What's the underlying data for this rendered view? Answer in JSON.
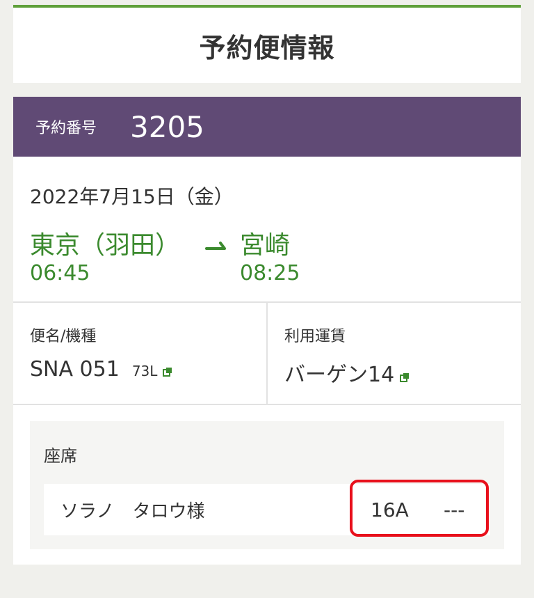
{
  "header": {
    "title": "予約便情報"
  },
  "reservation": {
    "label": "予約番号",
    "number": "3205"
  },
  "flight": {
    "date": "2022年7月15日（金）",
    "origin": {
      "city": "東京（羽田）",
      "time": "06:45"
    },
    "destination": {
      "city": "宮崎",
      "time": "08:25"
    }
  },
  "flight_info": {
    "flight_label": "便名/機種",
    "flight_number": "SNA 051",
    "aircraft": "73L",
    "fare_label": "利用運賃",
    "fare_value": "バーゲン14"
  },
  "seat": {
    "title": "座席",
    "passenger": "ソラノ　タロウ様",
    "seat_number": "16A",
    "extra": "---"
  },
  "colors": {
    "accent_green": "#3b8a2e",
    "reservation_bar": "#604a75",
    "highlight_red": "#e8101c"
  },
  "icons": [
    "external-link-icon",
    "arrow-right-icon"
  ]
}
